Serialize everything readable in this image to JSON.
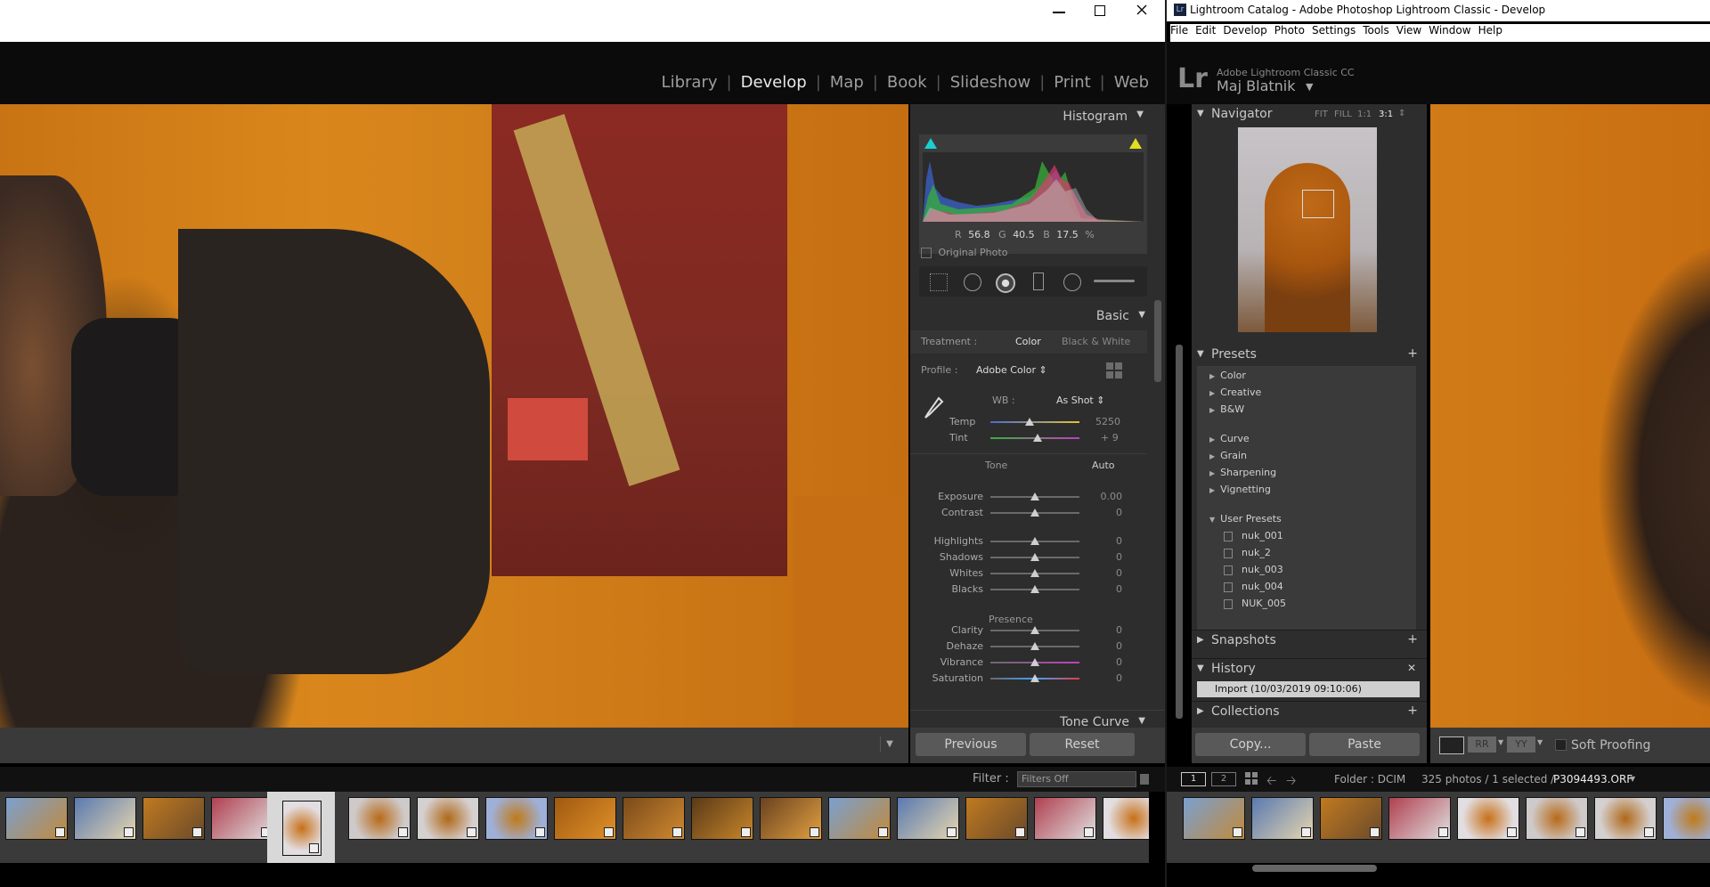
{
  "left": {
    "modules": [
      "Library",
      "Develop",
      "Map",
      "Book",
      "Slideshow",
      "Print",
      "Web"
    ],
    "active_module": "Develop",
    "histogram": {
      "title": "Histogram",
      "r_label": "R",
      "r_value": "56.8",
      "g_label": "G",
      "g_value": "40.5",
      "b_label": "B",
      "b_value": "17.5",
      "percent": "%",
      "original_photo": "Original Photo"
    },
    "basic": {
      "title": "Basic",
      "treatment_label": "Treatment :",
      "treatment_color": "Color",
      "treatment_bw": "Black & White",
      "profile_label": "Profile :",
      "profile_value": "Adobe Color",
      "wb_label": "WB :",
      "wb_value": "As Shot",
      "temp_label": "Temp",
      "temp_value": "5250",
      "temp_fraction": 0.44,
      "tint_label": "Tint",
      "tint_value": "+ 9",
      "tint_fraction": 0.53,
      "tone_label": "Tone",
      "auto_label": "Auto",
      "sliders": [
        {
          "label": "Exposure",
          "value": "0.00"
        },
        {
          "label": "Contrast",
          "value": "0"
        },
        {
          "label": "Highlights",
          "value": "0"
        },
        {
          "label": "Shadows",
          "value": "0"
        },
        {
          "label": "Whites",
          "value": "0"
        },
        {
          "label": "Blacks",
          "value": "0"
        },
        {
          "label": "Clarity",
          "value": "0"
        },
        {
          "label": "Dehaze",
          "value": "0"
        },
        {
          "label": "Vibrance",
          "value": "0"
        },
        {
          "label": "Saturation",
          "value": "0"
        }
      ],
      "presence_label": "Presence"
    },
    "tone_curve": "Tone Curve",
    "previous_button": "Previous",
    "reset_button": "Reset",
    "filter_label": "Filter :",
    "filter_value": "Filters Off"
  },
  "right": {
    "title_bar": "Lightroom Catalog - Adobe Photoshop Lightroom Classic - Develop",
    "menu": [
      "File",
      "Edit",
      "Develop",
      "Photo",
      "Settings",
      "Tools",
      "View",
      "Window",
      "Help"
    ],
    "app_name": "Adobe Lightroom Classic CC",
    "user_name": "Maj Blatnik",
    "navigator": {
      "title": "Navigator",
      "fit": "FIT",
      "fill": "FILL",
      "one": "1:1",
      "three": "3:1"
    },
    "presets": {
      "title": "Presets",
      "groups": [
        "Color",
        "Creative",
        "B&W",
        "Curve",
        "Grain",
        "Sharpening",
        "Vignetting"
      ],
      "user_presets": "User Presets",
      "user_items": [
        "nuk_001",
        "nuk_2",
        "nuk_003",
        "nuk_004",
        "NUK_005"
      ]
    },
    "snapshots": "Snapshots",
    "history": {
      "title": "History",
      "item": "Import (10/03/2019 09:10:06)"
    },
    "collections": "Collections",
    "copy_button": "Copy...",
    "paste_button": "Paste",
    "soft_proofing": "Soft Proofing",
    "page_1": "1",
    "page_2": "2",
    "folder": "Folder : DCIM",
    "count": "325 photos / 1 selected /",
    "filename": "P3094493.ORF"
  },
  "colors": {
    "accent": "#d9861a",
    "panel": "#3a3a3a",
    "background": "#1b1b1b"
  }
}
